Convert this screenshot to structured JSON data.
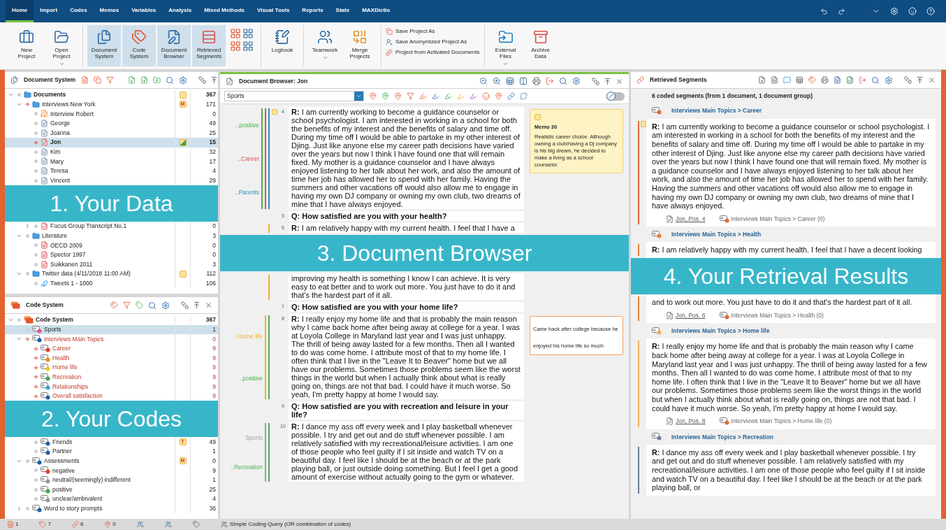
{
  "menu_tabs": [
    {
      "label": "Home",
      "selected": true
    },
    {
      "label": "Import",
      "selected": false
    },
    {
      "label": "Codes",
      "selected": false
    },
    {
      "label": "Memos",
      "selected": false
    },
    {
      "label": "Variables",
      "selected": false
    },
    {
      "label": "Analysis",
      "selected": false
    },
    {
      "label": "Mixed Methods",
      "selected": false
    },
    {
      "label": "Visual Tools",
      "selected": false
    },
    {
      "label": "Reports",
      "selected": false
    },
    {
      "label": "Stats",
      "selected": false
    },
    {
      "label": "MAXDictio",
      "selected": false
    }
  ],
  "ribbon_groups": [
    [
      {
        "kind": "large",
        "label": "New Project",
        "selected": false
      },
      {
        "kind": "large",
        "label": "Open Project",
        "menu": true,
        "selected": false
      }
    ],
    [
      {
        "kind": "large",
        "label": "Document System",
        "selected": true
      },
      {
        "kind": "large",
        "label": "Code System",
        "selected": true
      },
      {
        "kind": "large",
        "label": "Document Browser",
        "selected": true
      },
      {
        "kind": "large",
        "label": "Retrieved Segments",
        "selected": true
      },
      {
        "kind": "layouts"
      }
    ],
    [
      {
        "kind": "large",
        "label": "Logbook",
        "selected": false
      }
    ],
    [
      {
        "kind": "large",
        "label": "Teamwork",
        "menu": true,
        "selected": false
      },
      {
        "kind": "large",
        "label": "Merge Projects",
        "selected": false
      }
    ],
    [
      {
        "kind": "small",
        "items": [
          "Save Project As",
          "Save Anonymized Project As",
          "Project from Activated Documents"
        ]
      }
    ],
    [
      {
        "kind": "large",
        "label": "External Files",
        "menu": true,
        "selected": false
      },
      {
        "kind": "large",
        "label": "Archive Data",
        "selected": false
      }
    ]
  ],
  "documents": {
    "title": "Document System",
    "tree": [
      {
        "label": "Documents",
        "kind": "folder",
        "count": "367",
        "expanded": true,
        "activated": false,
        "selected": false,
        "memo": {
          "kind": "plain"
        },
        "children": [
          {
            "label": "Interviews New York",
            "kind": "folder",
            "count": "171",
            "expanded": true,
            "activated": true,
            "selected": false,
            "memo": {
              "kind": "letter",
              "letter": "M"
            },
            "children": [
              {
                "label": "Interview Robert",
                "kind": "audio",
                "count": "0",
                "activated": false,
                "selected": false
              },
              {
                "label": "George",
                "kind": "text",
                "count": "49",
                "activated": false,
                "selected": false
              },
              {
                "label": "Joanna",
                "kind": "text",
                "count": "25",
                "activated": false,
                "selected": false
              },
              {
                "label": "Jon",
                "kind": "open",
                "count": "15",
                "activated": true,
                "selected": true,
                "memo": {
                  "kind": "coded"
                }
              },
              {
                "label": "Kim",
                "kind": "text",
                "count": "32",
                "activated": false,
                "selected": false
              },
              {
                "label": "Mary",
                "kind": "text",
                "count": "17",
                "activated": false,
                "selected": false
              },
              {
                "label": "Teresa",
                "kind": "text",
                "count": "4",
                "activated": false,
                "selected": false
              },
              {
                "label": "Vincent",
                "kind": "text",
                "count": "29",
                "activated": false,
                "selected": false
              }
            ]
          },
          {
            "kind": "banner",
            "label": "1. Your Data"
          },
          {
            "children": [
              {
                "label": "Focus Group Transcript No.1",
                "kind": "transcript",
                "count": "0",
                "expanded": false,
                "activated": false,
                "selected": false
              }
            ]
          },
          {
            "label": "Literature",
            "kind": "folder",
            "count": "3",
            "expanded": true,
            "activated": false,
            "selected": false,
            "children": [
              {
                "label": "OECD 2009",
                "kind": "pdf",
                "count": "0",
                "activated": false,
                "selected": false
              },
              {
                "label": "Spector 1997",
                "kind": "pdf",
                "count": "0",
                "activated": false,
                "selected": false
              },
              {
                "label": "Suikkanen 2011",
                "kind": "pdf",
                "count": "3",
                "activated": false,
                "selected": false
              }
            ]
          },
          {
            "label": "Twitter data (4/11/2018 11:00 AM)",
            "kind": "folder",
            "count": "112",
            "expanded": true,
            "activated": false,
            "selected": false,
            "memo": {
              "kind": "plain"
            },
            "children": [
              {
                "label": "Tweets 1 - 1000",
                "kind": "tweet",
                "count": "106",
                "activated": false,
                "selected": false
              }
            ]
          }
        ]
      }
    ]
  },
  "codes": {
    "title": "Code System",
    "tree": [
      {
        "label": "Code System",
        "kind": "root",
        "count": "367",
        "expanded": true,
        "activated": false,
        "selected": false,
        "children": [
          {
            "label": "Sports",
            "color": "#e0559d",
            "count": "1",
            "activated": false,
            "selected": true
          },
          {
            "label": "Interviews Main Topics",
            "color": "#1f5fa8",
            "count": "0",
            "expanded": true,
            "activated": true,
            "selected": false,
            "children": [
              {
                "label": "Career",
                "color": "#e8392c",
                "count": "9",
                "activated": true,
                "selected": false
              },
              {
                "label": "Health",
                "color": "#f08a24",
                "count": "9",
                "activated": true,
                "selected": false
              },
              {
                "label": "Home life",
                "color": "#f3c318",
                "count": "9",
                "activated": true,
                "selected": false
              },
              {
                "label": "Recreation",
                "color": "#3aa64a",
                "count": "9",
                "activated": true,
                "selected": false
              },
              {
                "label": "Relationships",
                "color": "#3a9fd8",
                "count": "9",
                "activated": true,
                "selected": false
              },
              {
                "label": "Overall satisfaction",
                "color": "#1f5fa8",
                "count": "9",
                "activated": true,
                "selected": false
              }
            ]
          },
          {
            "kind": "banner",
            "label": "2. Your Codes"
          },
          {
            "children": [
              {
                "label": "Friends",
                "color": "#1f5fa8",
                "count": "49",
                "activated": false,
                "selected": false,
                "memo": {
                  "kind": "letter",
                  "letter": "T"
                }
              },
              {
                "label": "Partner",
                "color": "#1f5fa8",
                "count": "1",
                "activated": false,
                "selected": false
              }
            ]
          },
          {
            "label": "Assessments",
            "color": "#1f5fa8",
            "count": "0",
            "expanded": true,
            "activated": false,
            "selected": false,
            "memo": {
              "kind": "letter",
              "letter": "M"
            },
            "children": [
              {
                "label": "negative",
                "color": "#e8392c",
                "count": "9",
                "activated": false,
                "selected": false
              },
              {
                "label": "neutral/(seemingly) indifferent",
                "color": "#9a9a9a",
                "count": "1",
                "activated": false,
                "selected": false
              },
              {
                "label": "positive",
                "color": "#3aa64a",
                "count": "25",
                "activated": false,
                "selected": false
              },
              {
                "label": "unclear/ambivalent",
                "color": "#9a9a9a",
                "count": "4",
                "activated": false,
                "selected": false
              }
            ]
          },
          {
            "label": "Word to story prompts",
            "color": "#1f5fa8",
            "count": "36",
            "expanded": false,
            "activated": false,
            "selected": false
          }
        ]
      }
    ]
  },
  "browser": {
    "title": "Document Browser: Jon",
    "code_field": "Sports",
    "edit_mode": false,
    "paragraphs": [
      {
        "kind": "answer",
        "number": "4",
        "has_memo": true,
        "codes": [
          {
            "label": "..positive",
            "color": "#4caf50"
          },
          {
            "label": "..Career",
            "color": "#d9534f"
          },
          {
            "label": "..Parents",
            "color": "#2a8fbd"
          }
        ],
        "text": "**R:** I am currently working to become a guidance counselor or school psychologist. I am interested in working in a school for both the benefits of my interest and the benefits of salary and time off. During my time off I would be able to partake in my other interest of Djing. Just like anyone else my career path decisions have varied over the years but now I think I have found one that will remain fixed. My mother is a guidance counselor and I have always enjoyed listening to her talk about her work, and also the amount of time her job has allowed her to spend with her family. Having the summers and other vacations off would also allow me to engage in having my own DJ company or owning my own club, two dreams of mine that I have always enjoyed.",
        "memo": {
          "kind": "memo",
          "title": "Memo 30",
          "text": "Realistic career choice. Although owning a club/having a Dj company is his big dream, he decided to make a living as a school counselor."
        }
      },
      {
        "kind": "question",
        "number": "5",
        "text": "Q: How satisfied are you with your health?"
      },
      {
        "kind": "answer",
        "number": "6",
        "codes": [
          {
            "color": "#f0b030"
          }
        ],
        "text": "**R:** I am relatively happy with my current health. I feel that I have a"
      },
      {
        "kind": "banner",
        "label": "3. Document Browser"
      },
      {
        "kind": "continuation",
        "codes": [
          {
            "color": "#f0b030"
          }
        ],
        "text": "improving my health is something I know I can achieve. It is very easy to eat better and to work out more. You just have to do it and that's the hardest part of it all."
      },
      {
        "kind": "question",
        "number": "7",
        "text": "Q: How satisfied are you with your home life?"
      },
      {
        "kind": "answer",
        "number": "8",
        "codes": [
          {
            "label": "..Home life",
            "color": "#f0b030"
          },
          {
            "label": "..positive",
            "color": "#4caf50"
          }
        ],
        "text": "**R:** I really enjoy my home life and that is probably the main reason why I came back home after being away at college for a year. I was at Loyola College in Maryland last year and I was just unhappy. The thrill of being away lasted for a few months. Then all I wanted to do was come home. I attribute most of that to my home life. I often think that I live in the \"Leave It to Beaver\" home but we all have our problems. Sometimes those problems seem like the worst things in the world but when I actually think about what is really going on, things are not that bad. I could have it much worse. So yeah, I'm pretty happy at home I would say.",
        "memo": {
          "kind": "comment",
          "text": "Came back after college because he enjoyed his home life so much"
        }
      },
      {
        "kind": "question",
        "number": "9",
        "text": "Q: How satisfied are you with recreation and leisure in your life?"
      },
      {
        "kind": "answer",
        "number": "10",
        "codes": [
          {
            "label": "Sports",
            "color": "#a0a0a0"
          },
          {
            "label": "..Recreation",
            "color": "#4caf50"
          }
        ],
        "text": "**R:** I dance my ass off every week and I play basketball whenever possible. I try and get out and do stuff whenever possible. I am relatively satisfied with my recreational/leisure activities. I am one of those people who feel guilty if I sit inside and watch TV on a beautiful day. I feel like I should be at the beach or at the park playing ball, or just outside doing something. But I feel I get a good amount of exercise without actually going to the gym or whatever."
      }
    ]
  },
  "retrieved": {
    "title": "Retrieved Segments",
    "summary": "6 coded segments (from 1 document, 1 document group)",
    "items": [
      {
        "kind": "segment",
        "code": "Interviews Main Topics > Career",
        "color": "#e06a35",
        "has_memo": true,
        "text": "**R:** I am currently working to become a guidance counselor or school psychologist. I am interested in working in a school for both the benefits of my interest and the benefits of salary and time off. During my time off I would be able to partake in my other interest of Djing. Just like anyone else my career path decisions have varied over the years but now I think I have found one that will remain fixed. My mother is a guidance counselor and I have always enjoyed listening to her talk about her work, and also the amount of time her job has allowed her to spend with her family. Having the summers and other vacations off would also allow me to engage in having my own DJ company or owning my own club, two dreams of mine that I have always enjoyed.",
        "source": "Jon, Pos. 4",
        "code_ref": "Interviews Main Topics > Career (0)"
      },
      {
        "kind": "segment",
        "code": "Interviews Main Topics > Health",
        "color": "#e8803a",
        "text": "**R:** I am relatively happy with my current health. I feel that I have a decent looking"
      },
      {
        "kind": "banner",
        "label": "4. Your Retrieval Results"
      },
      {
        "kind": "continuation",
        "color": "#e8803a",
        "text": "and to work out more. You just have to do it and that's the hardest part of it all.",
        "source": "Jon, Pos. 6",
        "code_ref": "Interviews Main Topics > Health (0)"
      },
      {
        "kind": "segment",
        "code": "Interviews Main Topics > Home life",
        "color": "#f0b060",
        "text": "**R:** I really enjoy my home life and that is probably the main reason why I came back home after being away at college for a year. I was at Loyola College in Maryland last year and I was just unhappy. The thrill of being away lasted for a few months. Then all I wanted to do was come home. I attribute most of that to my home life. I often think that I live in the \"Leave It to Beaver\" home but we all have our problems. Sometimes those problems seem like the worst things in the world but when I actually think about what is really going on, things are not that bad. I could have it much worse. So yeah, I'm pretty happy at home I would say.",
        "source": "Jon, Pos. 8",
        "code_ref": "Interviews Main Topics > Home life (0)"
      },
      {
        "kind": "segment",
        "code": "Interviews Main Topics > Recreation",
        "color": "#6d7f95",
        "text": "**R:** I dance my ass off every week and I play basketball whenever possible. I try and get out and do stuff whenever possible. I am relatively satisfied with my recreational/leisure activities. I am one of those people who feel guilty if I sit inside and watch TV on a beautiful day. I feel like I should be at the beach or at the park playing ball, or"
      }
    ]
  },
  "status": {
    "counts": [
      "1",
      "7",
      "6",
      "0"
    ],
    "query": "Simple Coding Query (OR combination of codes)"
  }
}
